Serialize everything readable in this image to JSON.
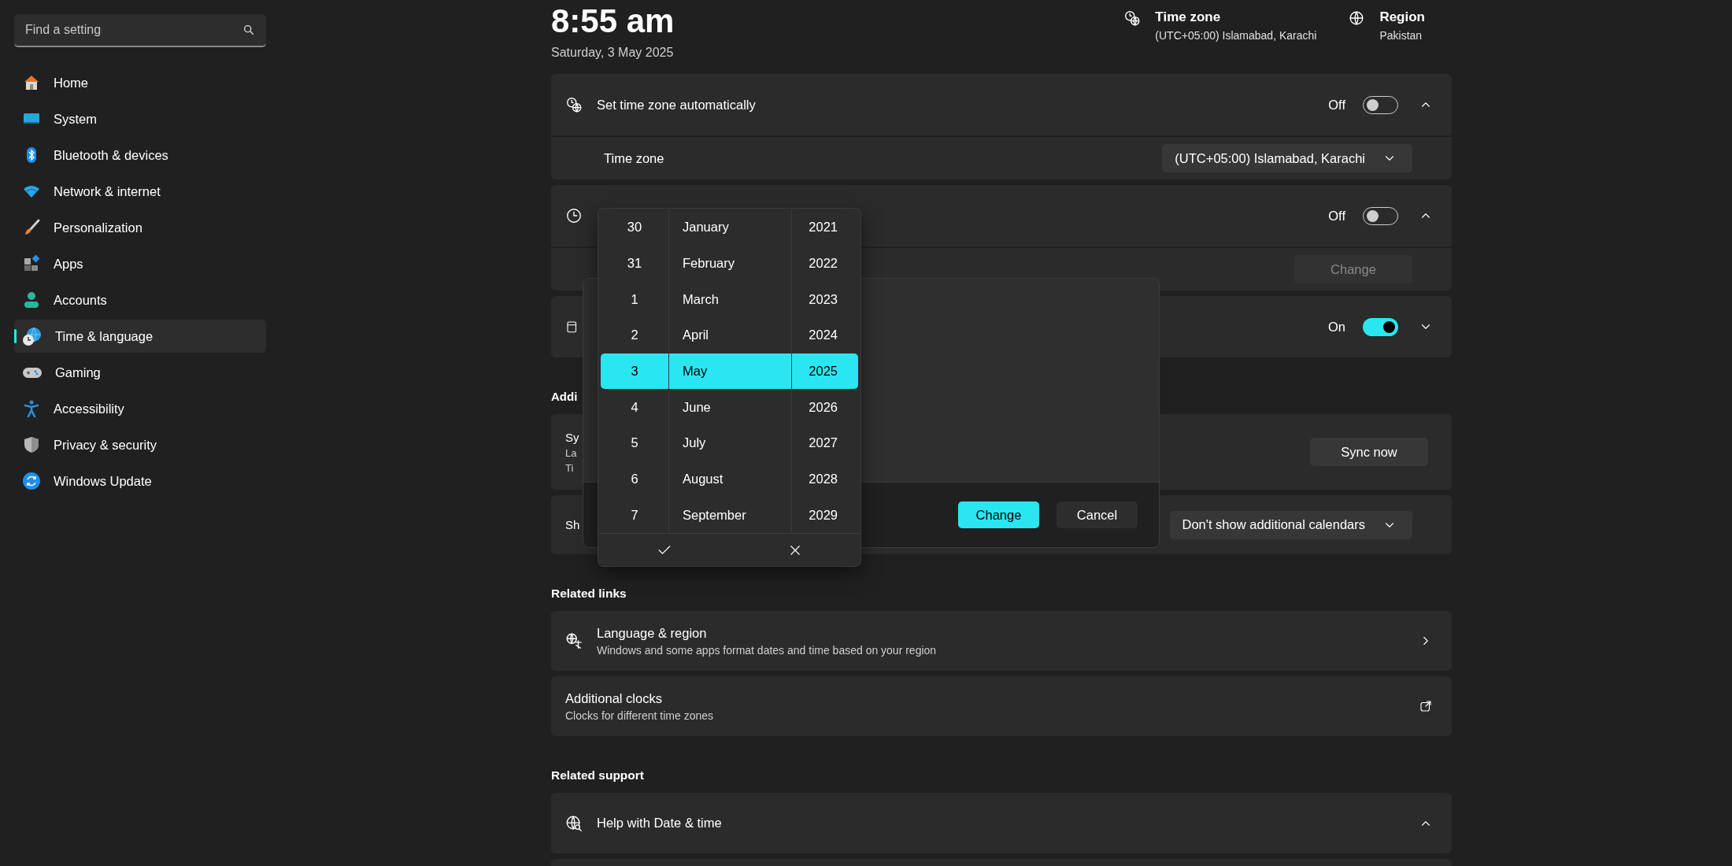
{
  "search": {
    "placeholder": "Find a setting"
  },
  "nav": [
    {
      "label": "Home",
      "selected": false
    },
    {
      "label": "System",
      "selected": false
    },
    {
      "label": "Bluetooth & devices",
      "selected": false
    },
    {
      "label": "Network & internet",
      "selected": false
    },
    {
      "label": "Personalization",
      "selected": false
    },
    {
      "label": "Apps",
      "selected": false
    },
    {
      "label": "Accounts",
      "selected": false
    },
    {
      "label": "Time & language",
      "selected": true
    },
    {
      "label": "Gaming",
      "selected": false
    },
    {
      "label": "Accessibility",
      "selected": false
    },
    {
      "label": "Privacy & security",
      "selected": false
    },
    {
      "label": "Windows Update",
      "selected": false
    }
  ],
  "header": {
    "time": "8:55 am",
    "date": "Saturday, 3 May 2025",
    "info": [
      {
        "title": "Time zone",
        "value": "(UTC+05:00) Islamabad, Karachi"
      },
      {
        "title": "Region",
        "value": "Pakistan"
      }
    ]
  },
  "sections": [
    {
      "cards": [
        {
          "rows": [
            {
              "kind": "toggle",
              "title": "Set time zone automatically",
              "state_label": "Off",
              "on": false,
              "expanded": true
            },
            {
              "kind": "dropdown",
              "title": "Time zone",
              "value": "(UTC+05:00) Islamabad, Karachi"
            }
          ]
        },
        {
          "rows": [
            {
              "kind": "toggle",
              "state_label": "Off",
              "on": false,
              "expanded": true
            },
            {
              "kind": "button",
              "button": "Change",
              "disabled": true
            }
          ]
        },
        {
          "rows": [
            {
              "kind": "toggle",
              "state_label": "On",
              "on": true,
              "expanded": false
            }
          ]
        }
      ]
    },
    {
      "heading": "Addi",
      "cards": [
        {
          "rows": [
            {
              "kind": "button",
              "title": "Sy",
              "lines": [
                "La",
                "Ti"
              ],
              "button": "Sync now",
              "disabled": false
            }
          ]
        },
        {
          "rows": [
            {
              "kind": "dropdown",
              "title": "Sh",
              "value": "Don't show additional calendars"
            }
          ]
        }
      ]
    },
    {
      "heading": "Related links",
      "cards": [
        {
          "rows": [
            {
              "kind": "link",
              "title": "Language & region",
              "lines": [
                "Windows and some apps format dates and time based on your region"
              ]
            }
          ]
        },
        {
          "rows": [
            {
              "kind": "external",
              "title": "Additional clocks",
              "lines": [
                "Clocks for different time zones"
              ]
            }
          ]
        }
      ]
    },
    {
      "heading": "Related support",
      "cards": [
        {
          "rows": [
            {
              "kind": "expander",
              "title": "Help with Date & time",
              "expanded": true
            }
          ]
        },
        {
          "rows": [
            {
              "kind": "blank"
            }
          ]
        }
      ]
    }
  ],
  "dialog": {
    "buttons": [
      {
        "label": "Change",
        "primary": true
      },
      {
        "label": "Cancel",
        "primary": false
      }
    ]
  },
  "date_picker": {
    "columns": [
      {
        "kind": "day",
        "items": [
          {
            "label": "30",
            "selected": false
          },
          {
            "label": "31",
            "selected": false
          },
          {
            "label": "1",
            "selected": false
          },
          {
            "label": "2",
            "selected": false
          },
          {
            "label": "3",
            "selected": true
          },
          {
            "label": "4",
            "selected": false
          },
          {
            "label": "5",
            "selected": false
          },
          {
            "label": "6",
            "selected": false
          },
          {
            "label": "7",
            "selected": false
          }
        ]
      },
      {
        "kind": "month",
        "items": [
          {
            "label": "January",
            "selected": false
          },
          {
            "label": "February",
            "selected": false
          },
          {
            "label": "March",
            "selected": false
          },
          {
            "label": "April",
            "selected": false
          },
          {
            "label": "May",
            "selected": true
          },
          {
            "label": "June",
            "selected": false
          },
          {
            "label": "July",
            "selected": false
          },
          {
            "label": "August",
            "selected": false
          },
          {
            "label": "September",
            "selected": false
          }
        ]
      },
      {
        "kind": "year",
        "items": [
          {
            "label": "2021",
            "selected": false
          },
          {
            "label": "2022",
            "selected": false
          },
          {
            "label": "2023",
            "selected": false
          },
          {
            "label": "2024",
            "selected": false
          },
          {
            "label": "2025",
            "selected": true
          },
          {
            "label": "2026",
            "selected": false
          },
          {
            "label": "2027",
            "selected": false
          },
          {
            "label": "2028",
            "selected": false
          },
          {
            "label": "2029",
            "selected": false
          }
        ]
      }
    ]
  }
}
